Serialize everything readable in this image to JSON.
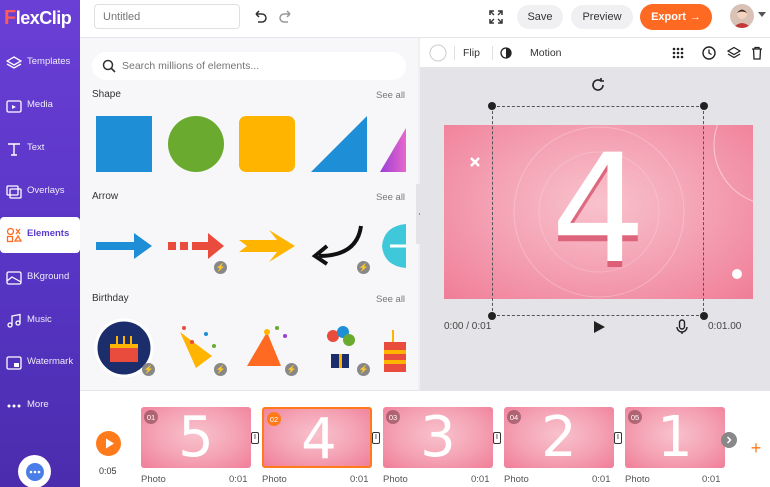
{
  "app": {
    "logo_f": "F",
    "logo_rest": "lexClip"
  },
  "topbar": {
    "title_placeholder": "Untitled",
    "save_label": "Save",
    "preview_label": "Preview",
    "export_label": "Export"
  },
  "sidebar": {
    "items": [
      {
        "label": "Templates",
        "icon": "layers-icon"
      },
      {
        "label": "Media",
        "icon": "folder-icon"
      },
      {
        "label": "Text",
        "icon": "text-icon"
      },
      {
        "label": "Overlays",
        "icon": "overlays-icon"
      },
      {
        "label": "Elements",
        "icon": "elements-icon",
        "active": true
      },
      {
        "label": "BKground",
        "icon": "background-icon"
      },
      {
        "label": "Music",
        "icon": "music-icon"
      },
      {
        "label": "Watermark",
        "icon": "watermark-icon"
      },
      {
        "label": "More",
        "icon": "more-icon"
      }
    ]
  },
  "elements_panel": {
    "search_placeholder": "Search millions of elements...",
    "sections": [
      {
        "title": "Shape",
        "see_all": "See all"
      },
      {
        "title": "Arrow",
        "see_all": "See all"
      },
      {
        "title": "Birthday",
        "see_all": "See all"
      }
    ]
  },
  "preview_toolbar": {
    "flip_label": "Flip",
    "motion_label": "Motion"
  },
  "canvas": {
    "big_number": "4",
    "time_current": "0:00 / 0:01",
    "time_total": "0:01.00"
  },
  "timeline": {
    "play_time": "0:05",
    "clips": [
      {
        "index": "01",
        "number": "5",
        "label": "Photo",
        "duration": "0:01"
      },
      {
        "index": "02",
        "number": "4",
        "label": "Photo",
        "duration": "0:01",
        "selected": true
      },
      {
        "index": "03",
        "number": "3",
        "label": "Photo",
        "duration": "0:01"
      },
      {
        "index": "04",
        "number": "2",
        "label": "Photo",
        "duration": "0:01"
      },
      {
        "index": "05",
        "number": "1",
        "label": "Photo",
        "duration": "0:01"
      }
    ]
  },
  "colors": {
    "sidebar": "#5b3ad0",
    "accent": "#ff6a22",
    "shape_blue": "#1e8fd6",
    "shape_green": "#6aaa2e",
    "shape_yellow": "#ffb400"
  }
}
